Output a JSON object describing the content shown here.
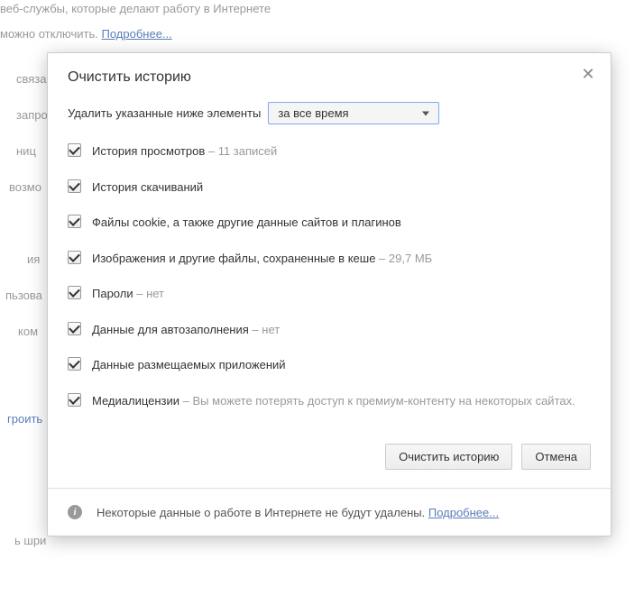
{
  "bg": {
    "line1": "веб-службы, которые делают работу в Интернете",
    "line2_prefix": "можно отключить. ",
    "line2_link": "Подробнее...",
    "frag1": "связа",
    "frag2": "запро",
    "frag3": "ниц",
    "frag4": "возмо",
    "frag5": "ия",
    "frag6": "пьзова",
    "frag7": "ком",
    "frag8": "гроить",
    "frag9": "ь шри"
  },
  "dialog": {
    "title": "Очистить историю",
    "time_label": "Удалить указанные ниже элементы",
    "time_selected": "за все время",
    "items": [
      {
        "label": "История просмотров",
        "detail": "11 записей",
        "checked": true
      },
      {
        "label": "История скачиваний",
        "detail": "",
        "checked": true
      },
      {
        "label": "Файлы cookie, а также другие данные сайтов и плагинов",
        "detail": "",
        "checked": true
      },
      {
        "label": "Изображения и другие файлы, сохраненные в кеше",
        "detail": "29,7 МБ",
        "checked": true
      },
      {
        "label": "Пароли",
        "detail": "нет",
        "checked": true
      },
      {
        "label": "Данные для автозаполнения",
        "detail": "нет",
        "checked": true
      },
      {
        "label": "Данные размещаемых приложений",
        "detail": "",
        "checked": true
      },
      {
        "label": "Медиалицензии",
        "detail": "Вы можете потерять доступ к премиум-контенту на некоторых сайтах.",
        "checked": true
      }
    ],
    "actions": {
      "confirm": "Очистить историю",
      "cancel": "Отмена"
    },
    "footer": {
      "text": "Некоторые данные о работе в Интернете не будут удалены. ",
      "link": "Подробнее..."
    }
  }
}
